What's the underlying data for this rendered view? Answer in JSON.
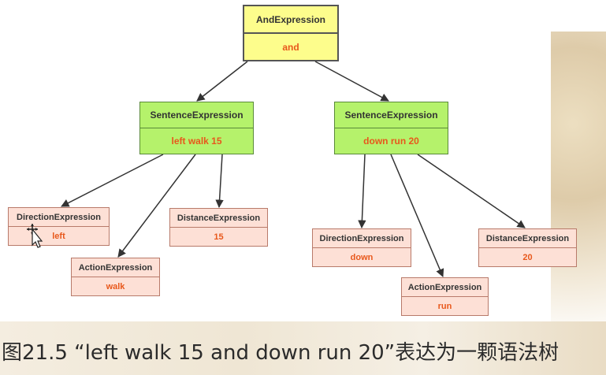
{
  "nodes": {
    "root": {
      "type": "AndExpression",
      "value": "and"
    },
    "sentence_left": {
      "type": "SentenceExpression",
      "value": "left walk 15"
    },
    "sentence_right": {
      "type": "SentenceExpression",
      "value": "down run 20"
    },
    "direction_left": {
      "type": "DirectionExpression",
      "value": "left"
    },
    "action_left": {
      "type": "ActionExpression",
      "value": "walk"
    },
    "distance_left": {
      "type": "DistanceExpression",
      "value": "15"
    },
    "direction_right": {
      "type": "DirectionExpression",
      "value": "down"
    },
    "action_right": {
      "type": "ActionExpression",
      "value": "run"
    },
    "distance_right": {
      "type": "DistanceExpression",
      "value": "20"
    }
  },
  "edges": [
    [
      "root",
      "sentence_left"
    ],
    [
      "root",
      "sentence_right"
    ],
    [
      "sentence_left",
      "direction_left"
    ],
    [
      "sentence_left",
      "action_left"
    ],
    [
      "sentence_left",
      "distance_left"
    ],
    [
      "sentence_right",
      "direction_right"
    ],
    [
      "sentence_right",
      "action_right"
    ],
    [
      "sentence_right",
      "distance_right"
    ]
  ],
  "caption": "图21.5 “left walk 15 and down run 20”表达为一颗语法树",
  "colors": {
    "root_fill": "#fdfd8c",
    "sentence_fill": "#b5f26b",
    "leaf_fill": "#fde0d6",
    "value_text": "#e8581c"
  }
}
